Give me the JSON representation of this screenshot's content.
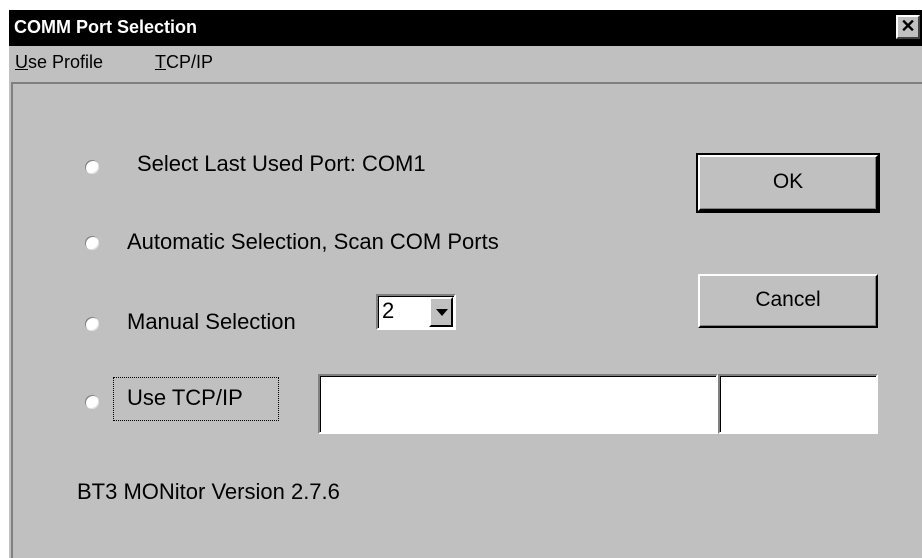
{
  "window": {
    "title": "COMM Port Selection",
    "close_glyph": "✕"
  },
  "menu": {
    "items": [
      {
        "label_underlined": "U",
        "label_rest": "se Profile"
      },
      {
        "label_underlined": "T",
        "label_rest": "CP/IP"
      }
    ]
  },
  "options": {
    "last_used": "Select Last Used Port:  COM1",
    "automatic": "Automatic Selection, Scan COM Ports",
    "manual": "Manual Selection",
    "tcpip": "Use TCP/IP"
  },
  "manual_port": {
    "selected": "2"
  },
  "tcpip_fields": {
    "address_value": "",
    "port_value": ""
  },
  "buttons": {
    "ok": "OK",
    "cancel": "Cancel"
  },
  "footer": {
    "version_text": "BT3 MONitor Version  2.7.6"
  },
  "colors": {
    "face": "#c0c0c0",
    "titlebar": "#000000",
    "title_text": "#ffffff"
  }
}
